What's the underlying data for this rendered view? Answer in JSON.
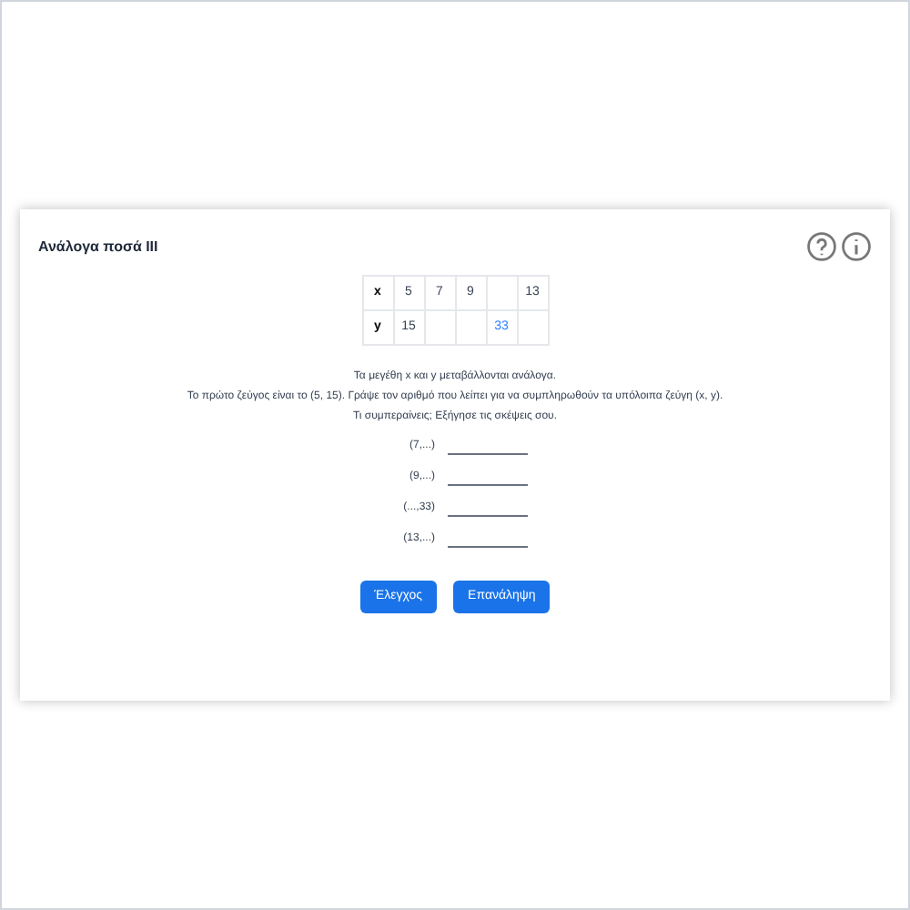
{
  "title": "Ανάλογα ποσά ΙΙΙ",
  "table": [
    {
      "label": "x",
      "cells": [
        {
          "text": "5",
          "highlighted": false
        },
        {
          "text": "7",
          "highlighted": false
        },
        {
          "text": "9",
          "highlighted": false
        },
        null,
        {
          "text": "13",
          "highlighted": false
        }
      ]
    },
    {
      "label": "y",
      "cells": [
        {
          "text": "15",
          "highlighted": false
        },
        null,
        null,
        {
          "text": "33",
          "highlighted": true
        },
        null
      ]
    }
  ],
  "instructions": [
    "Τα μεγέθη x και y μεταβάλλονται ανάλογα.",
    "Το πρώτο ζεύγος είναι το (5, 15). Γράψε τον αριθμό που λείπει για να συμπληρωθούν τα υπόλοιπα ζεύγη (x, y).",
    "Τι συμπεραίνεις; Εξήγησε τις σκέψεις σου."
  ],
  "pairs": [
    "(7,...)",
    "(9,...)",
    "(...,33)",
    "(13,...)"
  ],
  "buttons": [
    "Έλεγχος",
    "Επανάληψη"
  ]
}
